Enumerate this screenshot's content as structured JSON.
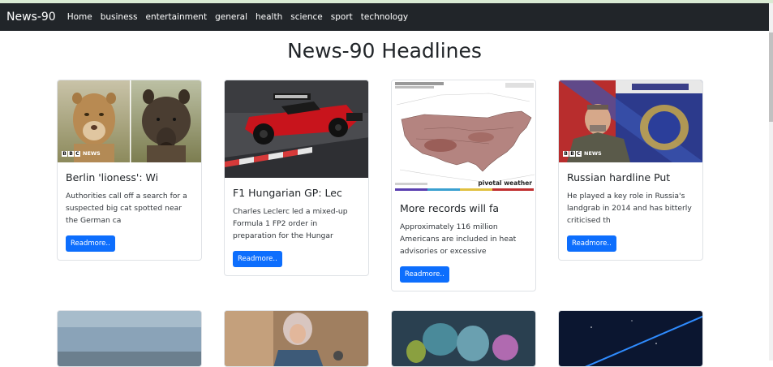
{
  "navbar": {
    "brand": "News-90",
    "links": [
      "Home",
      "business",
      "entertainment",
      "general",
      "health",
      "science",
      "sport",
      "technology"
    ]
  },
  "page_title": "News-90 Headlines",
  "cards": [
    {
      "title": "Berlin 'lioness': Wi",
      "text": "Authorities call off a search for a suspected big cat spotted near the German ca",
      "button": "Readmore..",
      "image_source": "BBC NEWS"
    },
    {
      "title": "F1 Hungarian GP: Lec",
      "text": "Charles Leclerc led a mixed-up Formula 1 FP2 order in preparation for the Hungar",
      "button": "Readmore.."
    },
    {
      "title": "More records will fa",
      "text": "Approximately 116 million Americans are included in heat advisories or excessive",
      "button": "Readmore..",
      "image_watermark": "pivotal weather"
    },
    {
      "title": "Russian hardline Put",
      "text": "He played a key role in Russia's landgrab in 2014 and has bitterly criticised th",
      "button": "Readmore..",
      "image_source": "BBC NEWS"
    }
  ],
  "colors": {
    "navbar_bg": "#212529",
    "button_bg": "#0d6efd"
  }
}
